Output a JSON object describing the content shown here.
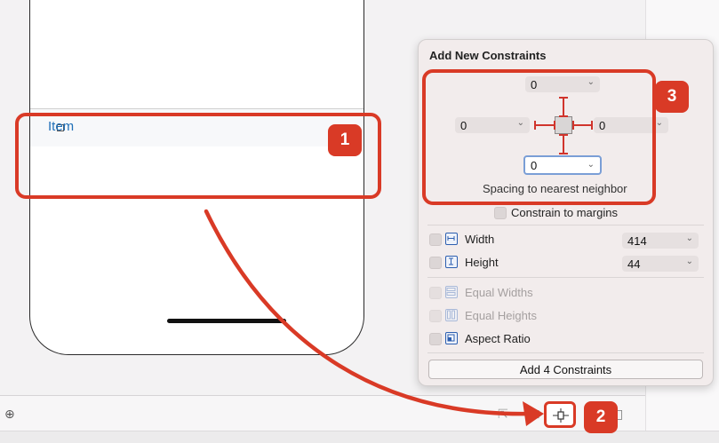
{
  "cell": {
    "label": "Item"
  },
  "popover": {
    "title": "Add New Constraints",
    "spacing": {
      "top": "0",
      "left": "0",
      "right": "0",
      "bottom": "0",
      "caption": "Spacing to nearest neighbor"
    },
    "constrain_to_margins": "Constrain to margins",
    "rows": [
      {
        "label": "Width",
        "value": "414"
      },
      {
        "label": "Height",
        "value": "44"
      },
      {
        "label": "Equal Widths"
      },
      {
        "label": "Equal Heights"
      },
      {
        "label": "Aspect Ratio"
      }
    ],
    "add_button": "Add 4 Constraints"
  },
  "badges": {
    "one": "1",
    "two": "2",
    "three": "3"
  },
  "colors": {
    "annotation_red": "#d93a26",
    "accent_blue": "#2d5fb0",
    "link_blue": "#1f6fb8"
  },
  "icons": {
    "zoom": "zoom-in-icon",
    "add_constraints": "add-constraints-icon"
  }
}
